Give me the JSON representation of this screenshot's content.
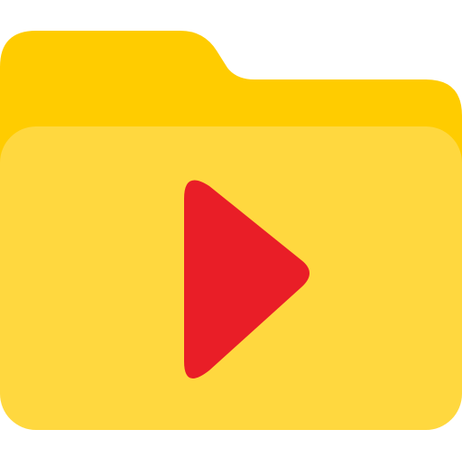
{
  "icon": {
    "name": "video-folder-icon",
    "parts": {
      "folder_back": "folder-back-tab",
      "folder_front": "folder-front-panel",
      "play": "play-icon"
    }
  },
  "colors": {
    "background": "#ffffff",
    "folder_back": "#FFCC00",
    "folder_front": "#FFD83F",
    "play": "#E91E27"
  }
}
